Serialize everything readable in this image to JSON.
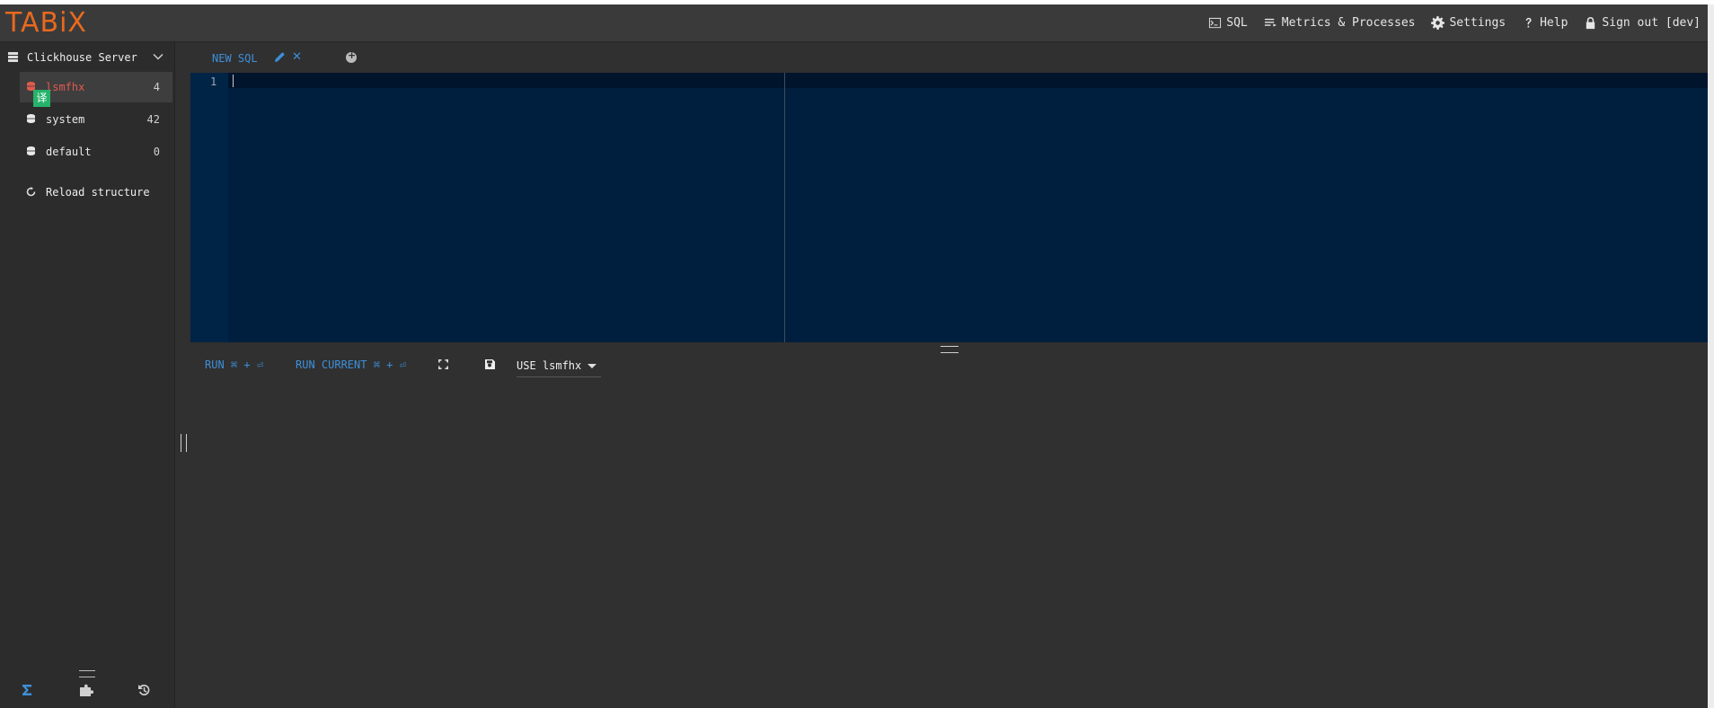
{
  "app": {
    "logo": "TABiX"
  },
  "topnav": [
    {
      "label": "SQL",
      "icon": "terminal-icon"
    },
    {
      "label": "Metrics & Processes",
      "icon": "list-icon"
    },
    {
      "label": "Settings",
      "icon": "gear-icon"
    },
    {
      "label": "Help",
      "icon": "question-icon"
    },
    {
      "label": "Sign out [dev]",
      "icon": "lock-icon"
    }
  ],
  "sidebar": {
    "server_label": "Clickhouse Server",
    "databases": [
      {
        "name": "lsmfhx",
        "count": "4",
        "active": true
      },
      {
        "name": "system",
        "count": "42",
        "active": false
      },
      {
        "name": "default",
        "count": "0",
        "active": false
      }
    ],
    "reload_label": "Reload structure",
    "badge_text": "译"
  },
  "tabs": [
    {
      "label": "NEW SQL"
    }
  ],
  "editor": {
    "line_numbers": [
      "1"
    ]
  },
  "toolbar": {
    "run_label": "RUN ⌘ + ⏎",
    "run_current_label": "RUN CURRENT ⌘ + ⏎",
    "use_db_value": "USE lsmfhx"
  },
  "colors": {
    "accent": "#3d8fd9",
    "logo": "#e8691e",
    "editor_bg": "#001f3f",
    "active_db": "#e05a4e",
    "badge": "#26b36b"
  }
}
